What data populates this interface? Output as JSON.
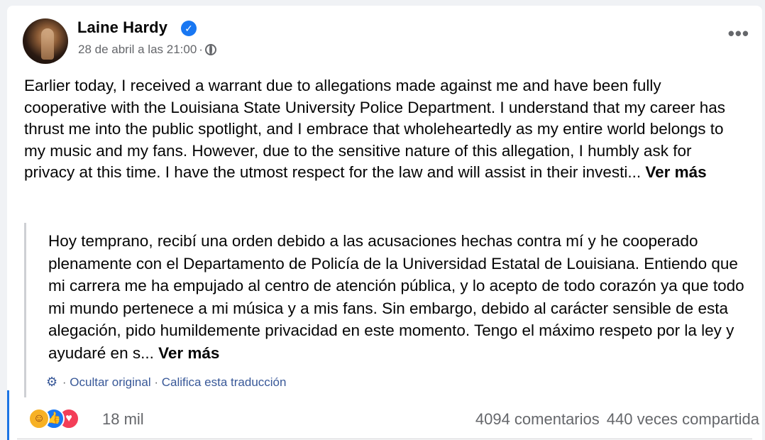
{
  "post": {
    "author": "Laine Hardy",
    "timestamp": "28 de abril a las 21:00",
    "privacy_icon": "globe-icon",
    "text": "Earlier today, I received a warrant due to allegations made against me and have been fully cooperative with the Louisiana State University Police Department. I understand that my career has thrust me into the public spotlight, and I embrace that wholeheartedly as my entire world belongs to my music and my fans. However, due to the sensitive nature of this allegation, I humbly ask for privacy at this time.  I have the utmost respect for the law and will assist in their investi...",
    "see_more": "Ver más"
  },
  "translation": {
    "text": "Hoy temprano, recibí una orden debido a las acusaciones hechas contra mí y he cooperado plenamente con el Departamento de Policía de la Universidad Estatal de Louisiana. Entiendo que mi carrera me ha empujado al centro de atención pública, y lo acepto de todo corazón ya que todo mi mundo pertenece a mi música y a mis fans. Sin embargo, debido al carácter sensible de esta alegación, pido humildemente privacidad en este momento. Tengo el máximo respeto por la ley y ayudaré en s...",
    "see_more": "Ver más",
    "hide_original": "Ocultar original",
    "rate_translation": "Califica esta traducción"
  },
  "stats": {
    "reactions_count": "18 mil",
    "comments": "4094 comentarios",
    "shares": "440 veces compartida"
  },
  "colors": {
    "accent": "#1877f2",
    "secondary_text": "#65676b",
    "love": "#f33e58",
    "care": "#f7b125"
  }
}
